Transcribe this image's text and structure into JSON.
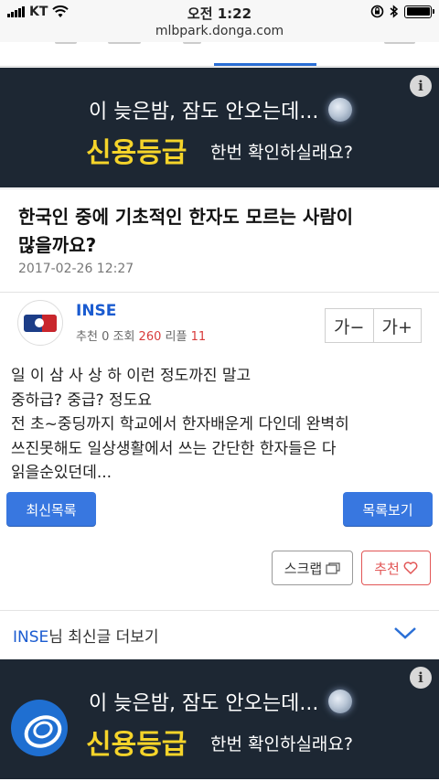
{
  "status_bar": {
    "carrier": "KT",
    "time": "오전 1:22"
  },
  "browser": {
    "url": "mlbpark.donga.com"
  },
  "ad_top": {
    "info": "i",
    "line1": "이 늦은밤, 잠도 안오는데...",
    "big": "신용등급",
    "small": "한번 확인하실래요?"
  },
  "post": {
    "title_line1": "한국인 중에 기초적인 한자도 모르는 사람이",
    "title_line2": "많을까요?",
    "date": "2017-02-26 12:27",
    "author": "INSE",
    "recommend_label": "추천",
    "recommend_count": "0",
    "views_label": "조회",
    "views_count": "260",
    "replies_label": "리플",
    "replies_count": "11",
    "font_smaller": "가−",
    "font_larger": "가+",
    "body": [
      "일 이 삼 사 상 하 이런 정도까진 말고",
      "중하급? 중급? 정도요",
      "전 초~중딩까지 학교에서 한자배운게 다인데 완벽히",
      "쓰진못해도 일상생활에서 쓰는 간단한 한자들은 다",
      "읽을순있던데..."
    ]
  },
  "actions": {
    "latest_list": "최신목록",
    "view_list": "목록보기",
    "scrap": "스크랩",
    "recommend": "추천"
  },
  "more": {
    "author": "INSE",
    "suffix": "님 최신글 더보기"
  },
  "ad_bottom": {
    "info": "i",
    "line1": "이 늦은밤, 잠도 안오는데...",
    "big": "신용등급",
    "small": "한번 확인하실래요?"
  },
  "colors": {
    "accent_blue": "#3877e0",
    "link_blue": "#1a5bd0",
    "ad_background": "#1d2733",
    "ad_highlight": "#f5d42a",
    "count_red": "#d83b3b"
  }
}
